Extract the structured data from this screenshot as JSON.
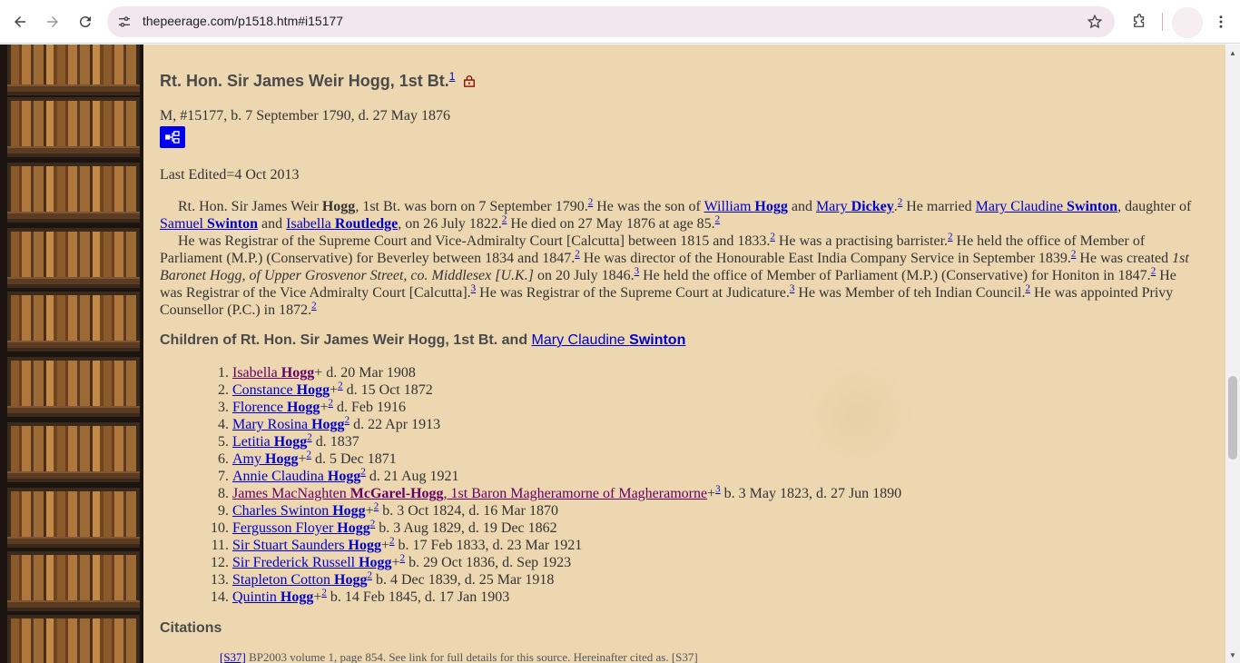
{
  "browser": {
    "url": "thepeerage.com/p1518.htm#i15177",
    "icons": [
      "back-icon",
      "forward-icon",
      "reload-icon",
      "site-info-icon",
      "bookmark-star-icon",
      "extensions-icon",
      "profile-avatar",
      "more-menu-icon"
    ]
  },
  "person": {
    "name": "Rt. Hon. Sir James Weir Hogg, 1st Bt.",
    "title_ref": "1",
    "meta": "M, #15177, b. 7 September 1790, d. 27 May 1876",
    "last_edited": "Last Edited=4 Oct 2013"
  },
  "bio": {
    "p1": {
      "t1": "Rt. Hon. Sir James Weir ",
      "surname": "Hogg",
      "t2": ", 1st Bt. was born on 7 September 1790.",
      "r1": "2",
      "t3": " He was the son of ",
      "father_first": "William ",
      "father_last": "Hogg",
      "t4": " and ",
      "mother_first": "Mary ",
      "mother_last": "Dickey",
      "t5": ".",
      "r2": "2",
      "t6": " He married ",
      "spouse_first": "Mary Claudine ",
      "spouse_last": "Swinton",
      "t7": ", daughter of ",
      "sfather_first": "Samuel ",
      "sfather_last": "Swinton",
      "t8": " and ",
      "smother_first": "Isabella ",
      "smother_last": "Routledge",
      "t9": ", on 26 July 1822.",
      "r3": "2",
      "t10": " He died on 27 May 1876 at age 85.",
      "r4": "2"
    },
    "p2": {
      "t1": "He was Registrar of the Supreme Court and Vice-Admiralty Court [Calcutta] between 1815 and 1833.",
      "r1": "2",
      "t2": " He was a practising barrister.",
      "r2": "2",
      "t3": " He held the office of Member of Parliament (M.P.) (Conservative) for Beverley between 1834 and 1847.",
      "r3": "2",
      "t4": " He was director of the Honourable East India Company Service in September 1839.",
      "r4": "2",
      "t5": " He was created ",
      "italic": "1st Baronet Hogg, of Upper Grosvenor Street, co. Middlesex [U.K.]",
      "t6": " on 20 July 1846.",
      "r5": "3",
      "t7": " He held the office of Member of Parliament (M.P.) (Conservative) for Honiton in 1847.",
      "r6": "2",
      "t8": " He was Registrar of the Vice Admiralty Court [Calcutta].",
      "r7": "3",
      "t9": " He was Registrar of the Supreme Court at Judicature.",
      "r8": "3",
      "t10": " He was Member of teh Indian Council.",
      "r9": "2",
      "t11": " He was appointed Privy Counsellor (P.C.) in 1872.",
      "r10": "2"
    }
  },
  "children_heading": {
    "prefix": "Children of Rt. Hon. Sir James Weir Hogg, 1st Bt. and ",
    "spouse_first": "Mary Claudine ",
    "spouse_last": "Swinton"
  },
  "children": [
    {
      "first": "Isabella ",
      "last": "Hogg",
      "suffix": "",
      "visited": true,
      "plus": "+",
      "ref": "",
      "dates": " d. 20 Mar 1908"
    },
    {
      "first": "Constance ",
      "last": "Hogg",
      "suffix": "",
      "visited": false,
      "plus": "+",
      "ref": "2",
      "dates": " d. 15 Oct 1872"
    },
    {
      "first": "Florence ",
      "last": "Hogg",
      "suffix": "",
      "visited": false,
      "plus": "+",
      "ref": "2",
      "dates": " d. Feb 1916"
    },
    {
      "first": "Mary Rosina ",
      "last": "Hogg",
      "suffix": "",
      "visited": false,
      "plus": "",
      "ref": "2",
      "dates": " d. 22 Apr 1913"
    },
    {
      "first": "Letitia ",
      "last": "Hogg",
      "suffix": "",
      "visited": false,
      "plus": "",
      "ref": "2",
      "dates": " d. 1837"
    },
    {
      "first": "Amy ",
      "last": "Hogg",
      "suffix": "",
      "visited": false,
      "plus": "+",
      "ref": "2",
      "dates": " d. 5 Dec 1871"
    },
    {
      "first": "Annie Claudina ",
      "last": "Hogg",
      "suffix": "",
      "visited": false,
      "plus": "",
      "ref": "2",
      "dates": " d. 21 Aug 1921"
    },
    {
      "first": "James MacNaghten ",
      "last": "McGarel-Hogg",
      "suffix": ", 1st Baron Magheramorne of Magheramorne",
      "visited": true,
      "plus": "+",
      "ref": "3",
      "dates": " b. 3 May 1823, d. 27 Jun 1890"
    },
    {
      "first": "Charles Swinton ",
      "last": "Hogg",
      "suffix": "",
      "visited": false,
      "plus": "+",
      "ref": "2",
      "dates": " b. 3 Oct 1824, d. 16 Mar 1870"
    },
    {
      "first": "Fergusson Floyer ",
      "last": "Hogg",
      "suffix": "",
      "visited": false,
      "plus": "",
      "ref": "2",
      "dates": " b. 3 Aug 1829, d. 19 Dec 1862"
    },
    {
      "first": "Sir Stuart Saunders ",
      "last": "Hogg",
      "suffix": "",
      "visited": false,
      "plus": "+",
      "ref": "2",
      "dates": " b. 17 Feb 1833, d. 23 Mar 1921"
    },
    {
      "first": "Sir Frederick Russell ",
      "last": "Hogg",
      "suffix": "",
      "visited": false,
      "plus": "+",
      "ref": "2",
      "dates": " b. 29 Oct 1836, d. Sep 1923"
    },
    {
      "first": "Stapleton Cotton ",
      "last": "Hogg",
      "suffix": "",
      "visited": false,
      "plus": "",
      "ref": "2",
      "dates": " b. 4 Dec 1839, d. 25 Mar 1918"
    },
    {
      "first": "Quintin ",
      "last": "Hogg",
      "suffix": "",
      "visited": false,
      "plus": "+",
      "ref": "2",
      "dates": " b. 14 Feb 1845, d. 17 Jan 1903"
    }
  ],
  "citations": {
    "heading": "Citations",
    "first_ref": "[S37]",
    "first_text": " BP2003 volume 1, page 854. See link for full details for this source. Hereinafter cited as. [S37]"
  }
}
